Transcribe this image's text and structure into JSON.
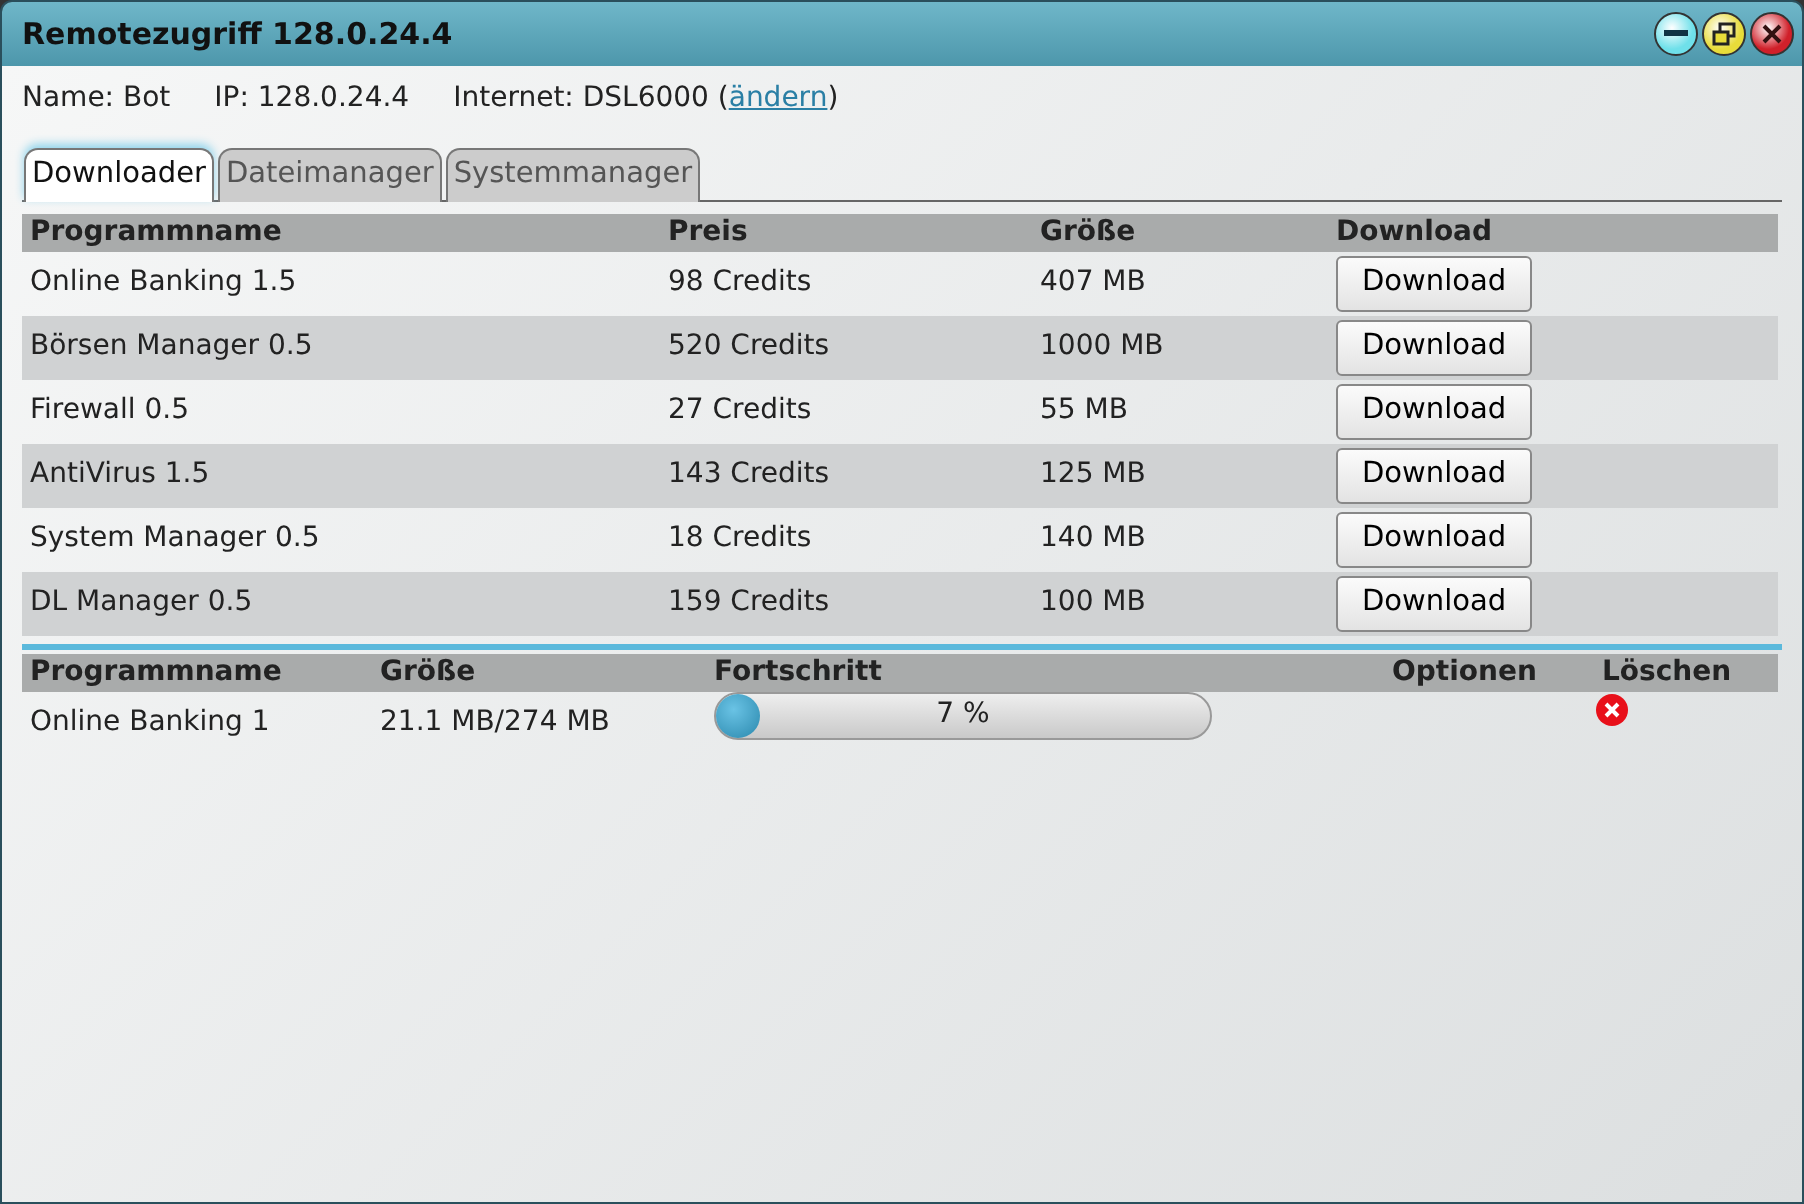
{
  "window": {
    "title": "Remotezugriff 128.0.24.4"
  },
  "info": {
    "name": "Name: Bot",
    "ip": "IP: 128.0.24.4",
    "internet": "Internet: DSL6000",
    "open_paren": "(",
    "link": "ändern",
    "close_paren": ")"
  },
  "tabs": [
    {
      "label": "Downloader",
      "selected": true
    },
    {
      "label": "Dateimanager",
      "selected": false
    },
    {
      "label": "Systemmanager",
      "selected": false
    }
  ],
  "downloads": {
    "columns": [
      "Programmname",
      "Preis",
      "Größe",
      "Download"
    ],
    "rows": [
      {
        "name": "Online Banking 1.5",
        "price": "98 Credits",
        "size": "407 MB",
        "button": "Download"
      },
      {
        "name": "Börsen Manager 0.5",
        "price": "520 Credits",
        "size": "1000 MB",
        "button": "Download"
      },
      {
        "name": "Firewall 0.5",
        "price": "27 Credits",
        "size": "55 MB",
        "button": "Download"
      },
      {
        "name": "AntiVirus 1.5",
        "price": "143 Credits",
        "size": "125 MB",
        "button": "Download"
      },
      {
        "name": "System Manager 0.5",
        "price": "18 Credits",
        "size": "140 MB",
        "button": "Download"
      },
      {
        "name": "DL Manager 0.5",
        "price": "159 Credits",
        "size": "100 MB",
        "button": "Download"
      }
    ]
  },
  "queue": {
    "columns": [
      "Programmname",
      "Größe",
      "Fortschritt",
      "Optionen",
      "Löschen"
    ],
    "rows": [
      {
        "name": "Online Banking 1",
        "size": "21.1 MB/274 MB",
        "level": 0.07,
        "reading": "7 %"
      }
    ]
  }
}
